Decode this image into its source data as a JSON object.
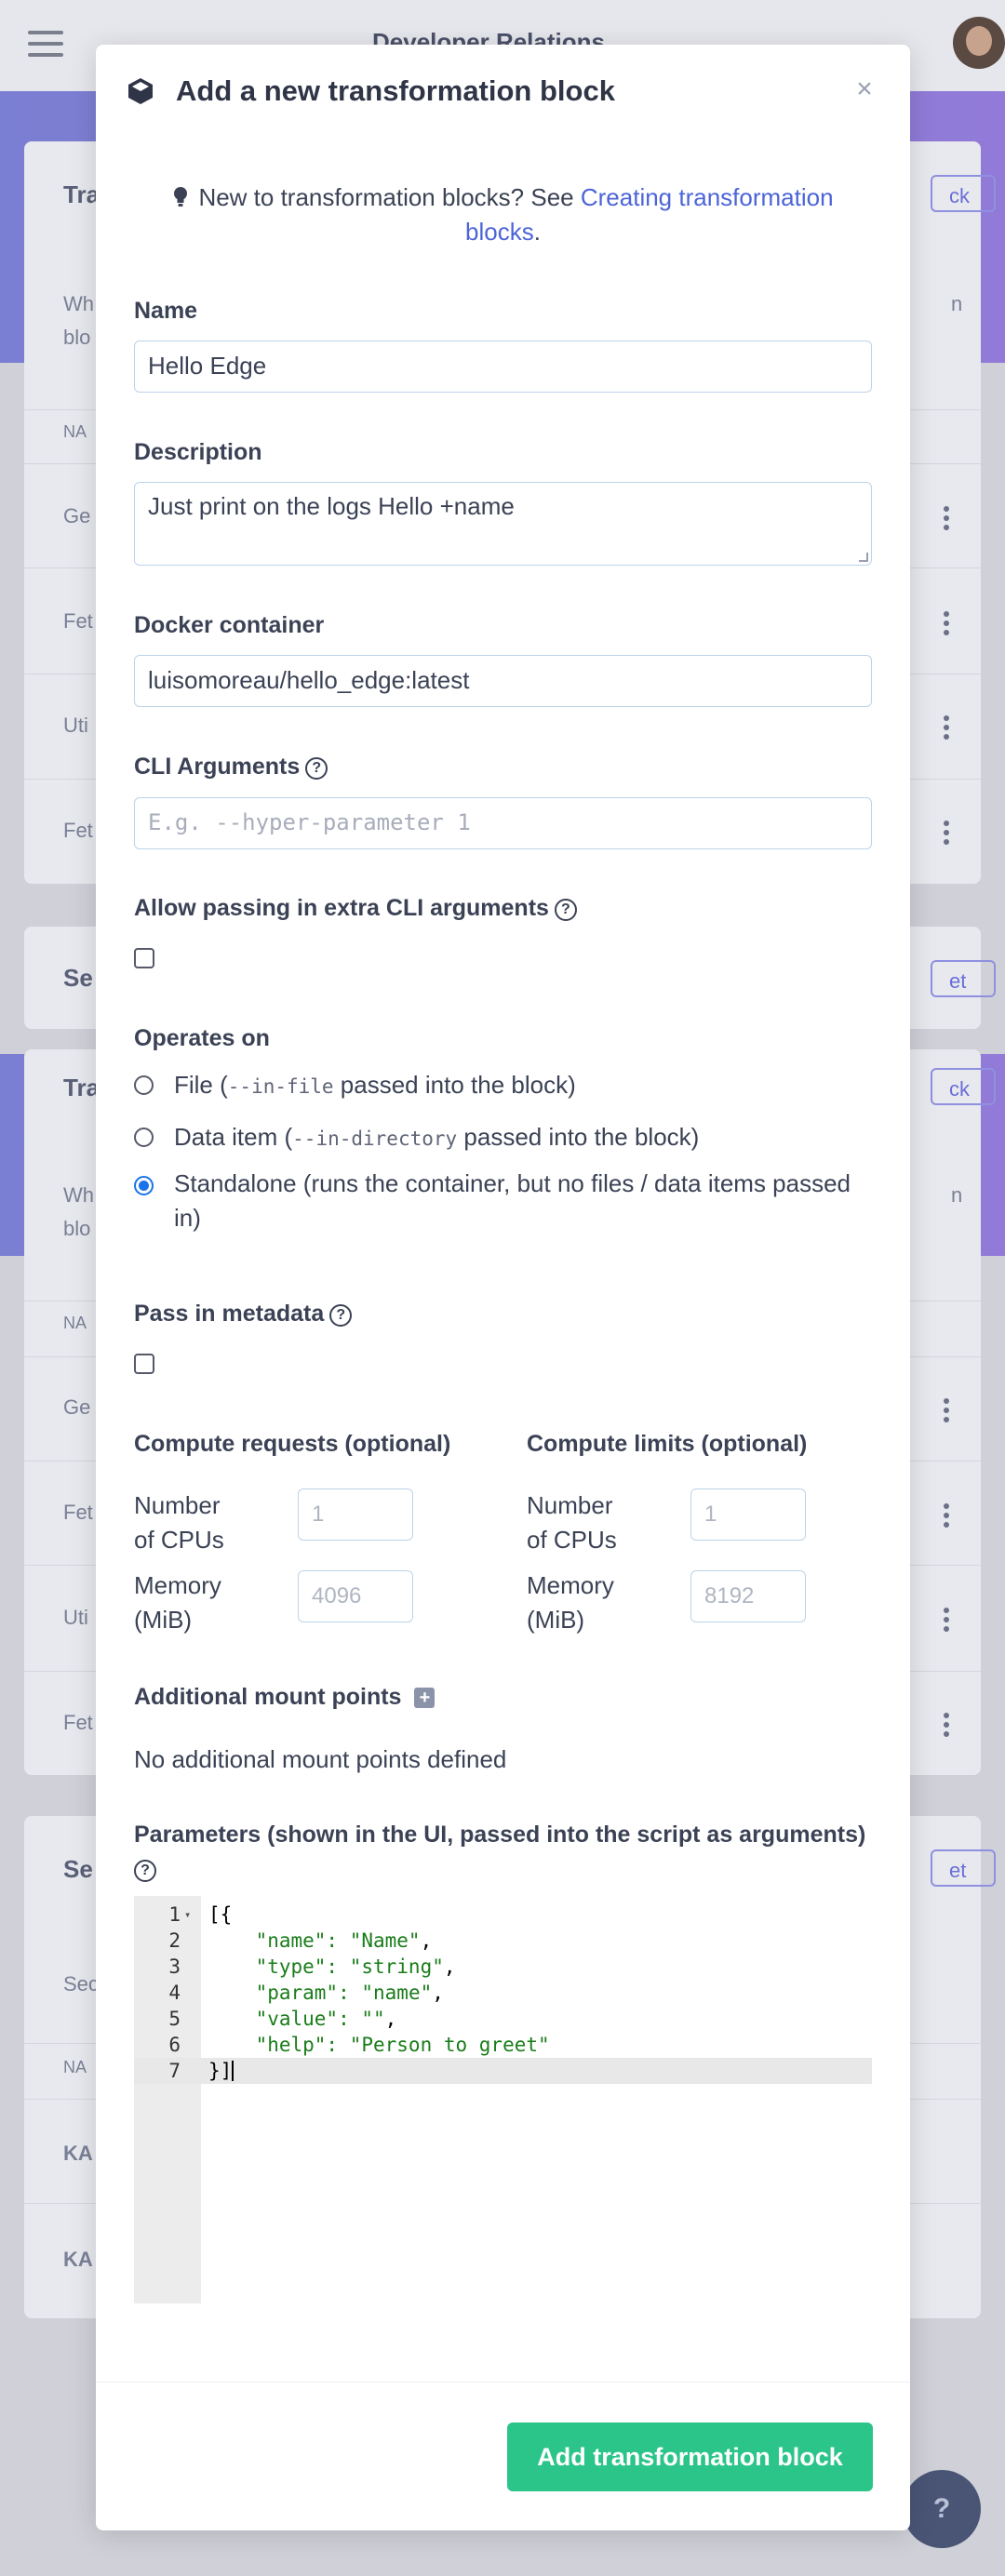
{
  "background": {
    "title": "Developer Relations",
    "card1_heading": "Tra",
    "card1_pill": "ck",
    "card1_text_line1": "Wh",
    "card1_text_line1_right": "n",
    "card1_text_line2": "blo",
    "card1_col": "NA",
    "card1_rows": [
      "Ge",
      "Fet",
      "Uti",
      "Fet"
    ],
    "card2_heading": "Se",
    "card2_pill": "et",
    "card3_heading": "Tra",
    "card3_pill": "ck",
    "card3_text_line1": "Wh",
    "card3_text_line1_right": "n",
    "card3_text_line2": "blo",
    "card3_col": "NA",
    "card3_rows": [
      "Ge",
      "Fet",
      "Uti",
      "Fet"
    ],
    "card4_heading": "Se",
    "card4_pill": "et",
    "card4_text": "Sec",
    "card4_col": "NA",
    "card4_rows": [
      "KA",
      "KA"
    ],
    "help_fab": "?"
  },
  "modal": {
    "title": "Add a new transformation block",
    "close": "×",
    "info_prefix": "New to transformation blocks? See ",
    "info_link": "Creating transformation blocks",
    "info_suffix": ".",
    "name_label": "Name",
    "name_value": "Hello Edge",
    "description_label": "Description",
    "description_value": "Just print on the logs Hello +name",
    "docker_label": "Docker container",
    "docker_value": "luisomoreau/hello_edge:latest",
    "cli_label": "CLI Arguments",
    "cli_placeholder": "E.g. --hyper-parameter 1",
    "extra_cli_label": "Allow passing in extra CLI arguments",
    "operates_label": "Operates on",
    "op_file_a": "File (",
    "op_file_code": "--in-file",
    "op_file_b": " passed into the block)",
    "op_data_a": "Data item (",
    "op_data_code": "--in-directory",
    "op_data_b": " passed into the block)",
    "op_standalone_line1": "Standalone (runs the container, but no files / data items passed",
    "op_standalone_line2": "in)",
    "metadata_label": "Pass in metadata",
    "compute_requests_label": "Compute requests (optional)",
    "compute_limits_label": "Compute limits (optional)",
    "cpus_line1": "Number",
    "cpus_line2": "of CPUs",
    "memory_line1": "Memory",
    "memory_line2": "(MiB)",
    "req_cpus_placeholder": "1",
    "req_memory_placeholder": "4096",
    "lim_cpus_placeholder": "1",
    "lim_memory_placeholder": "8192",
    "mount_label": "Additional mount points",
    "mount_empty": "No additional mount points defined",
    "params_label": "Parameters (shown in the UI, passed into the script as arguments)",
    "code_lines": [
      {
        "n": "1",
        "text": "[{"
      },
      {
        "n": "2",
        "key": "    \"name\": ",
        "val": "\"Name\"",
        "end": ","
      },
      {
        "n": "3",
        "key": "    \"type\": ",
        "val": "\"string\"",
        "end": ","
      },
      {
        "n": "4",
        "key": "    \"param\": ",
        "val": "\"name\"",
        "end": ","
      },
      {
        "n": "5",
        "key": "    \"value\": ",
        "val": "\"\"",
        "end": ","
      },
      {
        "n": "6",
        "key": "    \"help\": ",
        "val": "\"Person to greet\"",
        "end": ""
      },
      {
        "n": "7",
        "text": "}]"
      }
    ],
    "submit_label": "Add transformation block"
  },
  "colors": {
    "primary": "#2bc58a",
    "link": "#4c64d8",
    "band": "#5a5fd0"
  }
}
